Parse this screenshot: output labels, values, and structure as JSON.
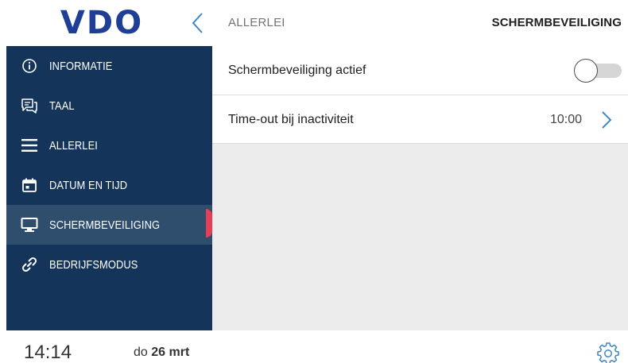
{
  "header": {
    "logo_text": "VDO",
    "breadcrumb": "ALLERLEI",
    "title": "SCHERMBEVEILIGING"
  },
  "sidebar": {
    "items": [
      {
        "label": "INFORMATIE",
        "icon": "info-icon",
        "active": false
      },
      {
        "label": "TAAL",
        "icon": "chat-icon",
        "active": false
      },
      {
        "label": "ALLERLEI",
        "icon": "menu-icon",
        "active": false
      },
      {
        "label": "DATUM EN TIJD",
        "icon": "calendar-icon",
        "active": false
      },
      {
        "label": "SCHERMBEVEILIGING",
        "icon": "monitor-icon",
        "active": true
      },
      {
        "label": "BEDRIJFSMODUS",
        "icon": "link-icon",
        "active": false
      }
    ]
  },
  "main": {
    "rows": [
      {
        "label": "Schermbeveiliging actief",
        "control": "toggle",
        "enabled": false
      },
      {
        "label": "Time-out bij inactiviteit",
        "value": "10:00",
        "control": "chevron"
      }
    ]
  },
  "footer": {
    "time": "14:14",
    "day": "do",
    "date": "26 mrt",
    "settings_icon": "gear-icon"
  },
  "colors": {
    "brand": "#1f3e96",
    "sidebar_bg": "#143559",
    "sidebar_active": "#2f4d6c",
    "accent_marker": "#e73e58",
    "link_blue": "#3f86c6",
    "content_bg": "#ececec"
  }
}
